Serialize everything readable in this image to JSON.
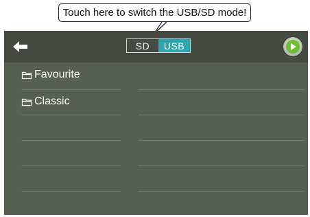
{
  "callout": {
    "text": "Touch here to switch the USB/SD mode!"
  },
  "header": {
    "back_icon": "back-arrow-icon",
    "mode_options": [
      "SD",
      "USB"
    ],
    "selected_mode": "USB",
    "play_icon": "play-icon"
  },
  "folders": [
    {
      "name": "Favourite",
      "icon": "folder-icon"
    },
    {
      "name": "Classic",
      "icon": "folder-icon"
    }
  ],
  "colors": {
    "screen_bg": "#586053",
    "topbar_bg": "#454b42",
    "usb_accent": "#2fa5b0",
    "play_green": "#6cbf2f"
  }
}
